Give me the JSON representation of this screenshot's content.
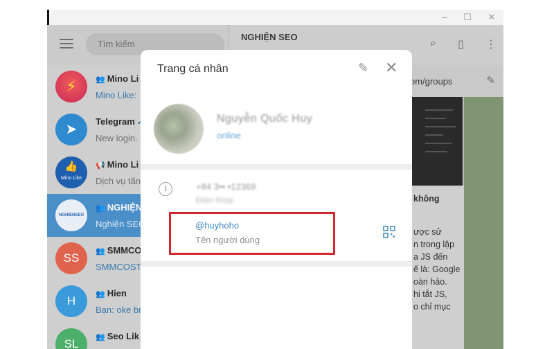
{
  "window": {
    "controls": {
      "minimize": "–",
      "maximize": "☐",
      "close": "✕"
    }
  },
  "sidebar": {
    "search_placeholder": "Tìm kiếm",
    "chats": [
      {
        "name": "Mino Li",
        "preview": "Mino Like:",
        "avatar_color": "#d9364f",
        "type": "group"
      },
      {
        "name": "Telegram",
        "preview": "New login.",
        "avatar_color": "#2e8bd0",
        "type": "service"
      },
      {
        "name": "Mino Li",
        "preview": "Dịch vụ tăn",
        "avatar_color": "#1f5fb0",
        "avatar_text": "Mino Like",
        "type": "channel"
      },
      {
        "name": "NGHIỆN",
        "preview": "Nghiện SEO",
        "avatar_color": "#e8eef6",
        "type": "group",
        "active": true
      },
      {
        "name": "SMMCO",
        "preview": "SMMCOST",
        "avatar_text": "SS",
        "avatar_color": "#e0634d",
        "type": "group"
      },
      {
        "name": "Hien",
        "preview": "Bạn: oke br",
        "avatar_text": "H",
        "avatar_color": "#3b9ad9",
        "type": "group"
      },
      {
        "name": "Seo Lik",
        "preview": "",
        "avatar_text": "SL",
        "avatar_color": "#4caf6a",
        "type": "group"
      }
    ]
  },
  "chat_panel": {
    "title": "NGHIỆN SEO",
    "pinned_text": "om/groups",
    "message_lines": [
      "không",
      "",
      "ược sử",
      "n trong lập",
      "a JS đến",
      "ế là: Google",
      "oàn hảo.",
      "hi tắt JS,",
      "o chỉ mục"
    ]
  },
  "profile_modal": {
    "title": "Trang cá nhân",
    "name": "Nguyễn Quốc Huy",
    "status": "online",
    "phone": "+84 3•• •12369",
    "phone_label": "Điện thoại",
    "username": "@huyhoho",
    "username_label": "Tên người dùng"
  },
  "colors": {
    "accent": "#3f86c4",
    "highlight": "#d2272e",
    "active_chat": "#4a8fc7"
  }
}
